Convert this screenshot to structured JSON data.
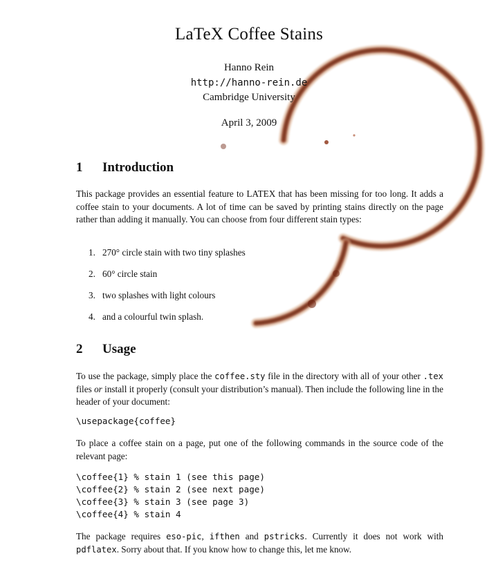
{
  "doc": {
    "title": "LaTeX Coffee Stains",
    "author": "Hanno Rein",
    "url": "http://hanno-rein.de",
    "affiliation": "Cambridge University",
    "date": "April 3, 2009"
  },
  "sections": [
    {
      "number": "1",
      "title": "Introduction"
    },
    {
      "number": "2",
      "title": "Usage"
    }
  ],
  "intro": {
    "paragraph": "This package provides an essential feature to LATEX that has been missing for too long. It adds a coffee stain to your documents. A lot of time can be saved by printing stains directly on the page rather than adding it manually. You can choose from four different stain types:",
    "list": [
      {
        "n": "1.",
        "text": "270° circle stain with two tiny splashes"
      },
      {
        "n": "2.",
        "text": "60° circle stain"
      },
      {
        "n": "3.",
        "text": "two splashes with light colours"
      },
      {
        "n": "4.",
        "text": "and a colourful twin splash."
      }
    ]
  },
  "usage": {
    "p1_a": "To use the package, simply place the ",
    "p1_file": "coffee.sty",
    "p1_b": " file in the directory with all of your other ",
    "p1_tex": ".tex",
    "p1_c": " files ",
    "p1_or": "or",
    "p1_d": " install it properly (consult your distribution’s manual). Then include the following line in the header of your document:",
    "usepackage": "\\usepackage{coffee}",
    "p2": "To place a coffee stain on a page, put one of the following commands in the source code of the relevant page:",
    "commands": [
      "\\coffee{1} % stain 1 (see this page)",
      "\\coffee{2} % stain 2 (see next page)",
      "\\coffee{3} % stain 3 (see page 3)",
      "\\coffee{4} % stain 4"
    ],
    "p3_a": "The package requires ",
    "req1": "eso-pic",
    "p3_sep1": ", ",
    "req2": "ifthen",
    "p3_and": " and ",
    "req3": "pstricks",
    "p3_b": ". Currently it does not work with ",
    "req4": "pdflatex",
    "p3_c": ". Sorry about that. If you know how to change this, let me know."
  },
  "colors": {
    "stain_dark": "#6b1f0c",
    "stain_mid": "#a3421e",
    "stain_light": "#d9a07a"
  }
}
